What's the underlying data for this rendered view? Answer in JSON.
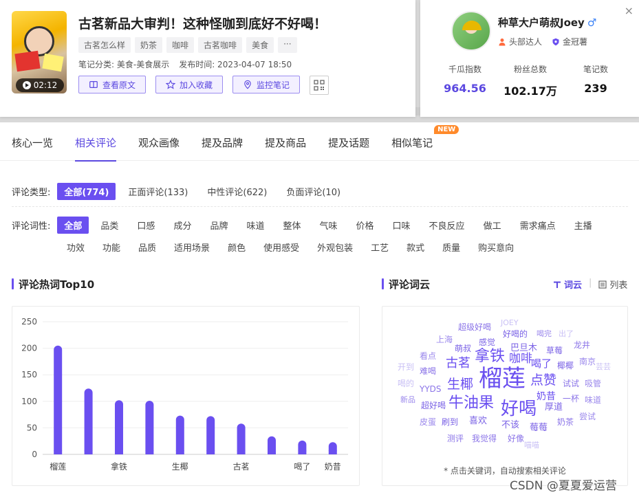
{
  "note": {
    "duration": "02:12",
    "title": "古茗新品大审判！这种怪咖到底好不好喝！",
    "tags": [
      "古茗怎么样",
      "奶茶",
      "咖啡",
      "古茗咖啡",
      "美食",
      "···"
    ],
    "category": "笔记分类: 美食-美食展示",
    "publish_time": "发布时间: 2023-04-07 18:50",
    "buttons": {
      "view_original": "查看原文",
      "favorite": "加入收藏",
      "monitor": "监控笔记"
    }
  },
  "author": {
    "name": "种草大户萌叔Joey",
    "gender_icon": "♂",
    "badges": [
      "头部达人",
      "金冠薯"
    ],
    "stats": [
      {
        "label": "千瓜指数",
        "value": "964.56"
      },
      {
        "label": "粉丝总数",
        "value": "102.17万"
      },
      {
        "label": "笔记数",
        "value": "239"
      }
    ],
    "close": "×"
  },
  "tabs": [
    "核心一览",
    "相关评论",
    "观众画像",
    "提及品牌",
    "提及商品",
    "提及话题",
    "相似笔记"
  ],
  "active_tab": 1,
  "new_badge": "NEW",
  "comment_type": {
    "label": "评论类型:",
    "options": [
      "全部(774)",
      "正面评论(133)",
      "中性评论(622)",
      "负面评论(10)"
    ]
  },
  "comment_pos": {
    "label": "评论词性:",
    "row1": [
      "全部",
      "品类",
      "口感",
      "成分",
      "品牌",
      "味道",
      "整体",
      "气味",
      "价格",
      "口味",
      "不良反应",
      "做工",
      "需求痛点",
      "主播"
    ],
    "row2": [
      "功效",
      "功能",
      "品质",
      "适用场景",
      "颜色",
      "使用感受",
      "外观包装",
      "工艺",
      "款式",
      "质量",
      "购买意向"
    ]
  },
  "hotwords_title": "评论热词Top10",
  "cloud_title": "评论词云",
  "view_toggle": {
    "cloud": "词云",
    "list": "列表"
  },
  "chart_data": {
    "type": "bar",
    "categories": [
      "榴莲",
      "",
      "拿铁",
      "",
      "生椰",
      "",
      "古茗",
      "",
      "喝了",
      "奶昔"
    ],
    "values": [
      205,
      124,
      102,
      101,
      73,
      72,
      58,
      34,
      26,
      23
    ],
    "ylim": [
      0,
      250
    ],
    "yticks": [
      0,
      50,
      100,
      150,
      200,
      250
    ],
    "color": "#6a4ff0",
    "grid": true
  },
  "cloud_words": [
    {
      "t": "超级好喝",
      "c": "#8b74e8"
    },
    {
      "t": "JOEY",
      "c": "#c9c0f5"
    },
    {
      "t": "好喝的",
      "c": "#7b63e6"
    },
    {
      "t": "喝完",
      "c": "#9b88ec"
    },
    {
      "t": "出了",
      "c": "#c9c0f5"
    },
    {
      "t": "上海",
      "c": "#9b88ec"
    },
    {
      "t": "感觉",
      "c": "#7b63e6"
    },
    {
      "t": "巴旦木",
      "c": "#7b63e6"
    },
    {
      "t": "龙井",
      "c": "#8b74e8"
    },
    {
      "t": "萌叔",
      "c": "#7b63e6"
    },
    {
      "t": "草莓",
      "c": "#7b63e6"
    },
    {
      "t": "看点",
      "c": "#9b88ec"
    },
    {
      "t": "拿铁",
      "c": "#6a4ff0"
    },
    {
      "t": "咖啡",
      "c": "#6a4ff0"
    },
    {
      "t": "南京",
      "c": "#9b88ec"
    },
    {
      "t": "开到",
      "c": "#c9c0f5"
    },
    {
      "t": "古茗",
      "c": "#6a4ff0"
    },
    {
      "t": "喝了",
      "c": "#6a4ff0"
    },
    {
      "t": "椰椰",
      "c": "#7b63e6"
    },
    {
      "t": "芸芸",
      "c": "#c9c0f5"
    },
    {
      "t": "难喝",
      "c": "#8b74e8"
    },
    {
      "t": "榴莲",
      "c": "#6a4ff0"
    },
    {
      "t": "点赞",
      "c": "#6a4ff0"
    },
    {
      "t": "喝的",
      "c": "#c9c0f5"
    },
    {
      "t": "生椰",
      "c": "#6a4ff0"
    },
    {
      "t": "试试",
      "c": "#8b74e8"
    },
    {
      "t": "吸管",
      "c": "#9b88ec"
    },
    {
      "t": "YYDS",
      "c": "#8b74e8"
    },
    {
      "t": "新品",
      "c": "#9b88ec"
    },
    {
      "t": "奶昔",
      "c": "#6a4ff0"
    },
    {
      "t": "一杯",
      "c": "#8b74e8"
    },
    {
      "t": "味道",
      "c": "#9b88ec"
    },
    {
      "t": "超好喝",
      "c": "#7b63e6"
    },
    {
      "t": "牛油果",
      "c": "#6a4ff0"
    },
    {
      "t": "好喝",
      "c": "#6a4ff0"
    },
    {
      "t": "厚道",
      "c": "#7b63e6"
    },
    {
      "t": "皮蛋",
      "c": "#9b88ec"
    },
    {
      "t": "刷到",
      "c": "#7b63e6"
    },
    {
      "t": "喜欢",
      "c": "#7b63e6"
    },
    {
      "t": "尝试",
      "c": "#9b88ec"
    },
    {
      "t": "不该",
      "c": "#7b63e6"
    },
    {
      "t": "奶茶",
      "c": "#8b74e8"
    },
    {
      "t": "莓莓",
      "c": "#7b63e6"
    },
    {
      "t": "测评",
      "c": "#8b74e8"
    },
    {
      "t": "我觉得",
      "c": "#8b74e8"
    },
    {
      "t": "好像",
      "c": "#8b74e8"
    },
    {
      "t": "喵喵",
      "c": "#c9c0f5"
    }
  ],
  "cloud_note": "* 点击关键词，自动搜索相关评论",
  "watermark": "CSDN @夏夏爱运营"
}
